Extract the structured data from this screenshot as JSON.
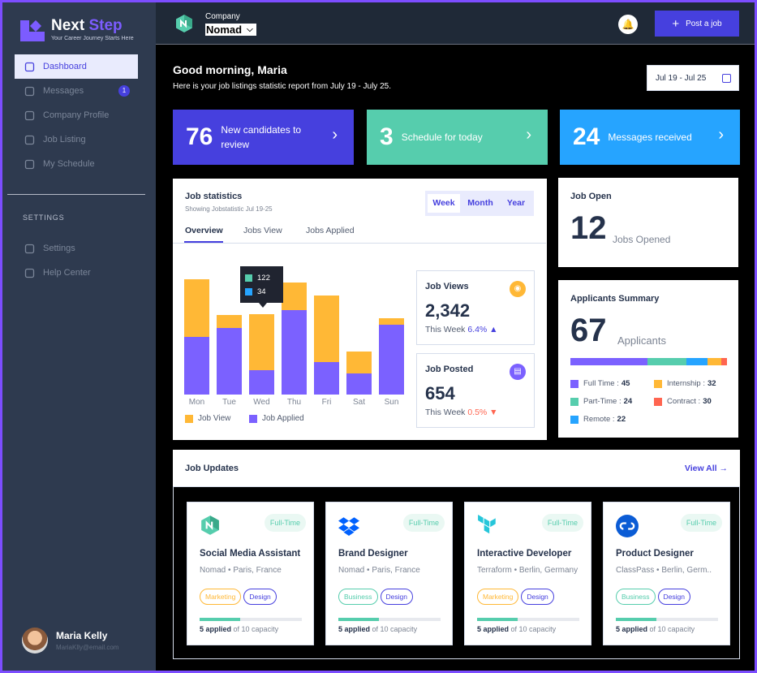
{
  "brand": {
    "title_a": "Next",
    "title_b": "Step",
    "tagline": "Your Career Journey Starts Here"
  },
  "nav": [
    {
      "label": "Dashboard",
      "icon": "home-icon",
      "active": true
    },
    {
      "label": "Messages",
      "icon": "message-icon",
      "badge": "1"
    },
    {
      "label": "Company Profile",
      "icon": "building-icon"
    },
    {
      "label": "Job Listing",
      "icon": "clipboard-icon"
    },
    {
      "label": "My Schedule",
      "icon": "calendar-icon"
    }
  ],
  "settings_heading": "SETTINGS",
  "settings_nav": [
    {
      "label": "Settings",
      "icon": "gear-icon"
    },
    {
      "label": "Help Center",
      "icon": "help-icon"
    }
  ],
  "user": {
    "name": "Maria Kelly",
    "email": "MariaKlly@email.com"
  },
  "header": {
    "company_label": "Company",
    "company_name": "Nomad",
    "post_label": "Post a job"
  },
  "greeting": {
    "title": "Good morning, Maria",
    "subtitle": "Here is your job listings statistic report from July 19 - July 25.",
    "date_range": "Jul 19 - Jul 25"
  },
  "stats": [
    {
      "num": "76",
      "line1": "New candidates to",
      "line2": "review",
      "color": "#4640de"
    },
    {
      "num": "3",
      "line1": "Schedule for today",
      "line2": "",
      "color": "#56cdad"
    },
    {
      "num": "24",
      "line1": "Messages received",
      "line2": "",
      "color": "#26a4ff"
    }
  ],
  "job_stats": {
    "title": "Job statistics",
    "subtitle": "Showing Jobstatistic Jul 19-25",
    "periods": [
      "Week",
      "Month",
      "Year"
    ],
    "tabs": [
      "Overview",
      "Jobs View",
      "Jobs Applied"
    ],
    "tooltip": {
      "view": "122",
      "applied": "34"
    },
    "views_card": {
      "title": "Job Views",
      "value": "2,342",
      "week_label": "This Week",
      "change": "6.4%"
    },
    "posted_card": {
      "title": "Job Posted",
      "value": "654",
      "week_label": "This Week",
      "change": "0.5%"
    }
  },
  "chart_data": {
    "type": "bar",
    "stacked": true,
    "categories": [
      "Mon",
      "Tue",
      "Wed",
      "Thu",
      "Fri",
      "Sat",
      "Sun"
    ],
    "series": [
      {
        "name": "Job View",
        "color": "#ffb836",
        "values": [
          73,
          17,
          71,
          35,
          84,
          27,
          8
        ]
      },
      {
        "name": "Job Applied",
        "color": "#7b61ff",
        "values": [
          73,
          84,
          31,
          107,
          41,
          27,
          88
        ]
      }
    ]
  },
  "job_open": {
    "title": "Job Open",
    "num": "12",
    "label": "Jobs Opened"
  },
  "applicants": {
    "title": "Applicants Summary",
    "num": "67",
    "label": "Applicants",
    "items": [
      {
        "name": "Full Time :",
        "value": "45",
        "color": "#7b61ff"
      },
      {
        "name": "Internship :",
        "value": "32",
        "color": "#ffb836"
      },
      {
        "name": "Part-Time :",
        "value": "24",
        "color": "#56cdad"
      },
      {
        "name": "Contract :",
        "value": "30",
        "color": "#ff6550"
      },
      {
        "name": "Remote :",
        "value": "22",
        "color": "#26a4ff"
      }
    ]
  },
  "updates": {
    "title": "Job Updates",
    "view_all": "View All",
    "jobs": [
      {
        "badge": "Full-Time",
        "title": "Social Media Assistant",
        "company": "Nomad",
        "location": "Paris, France",
        "tags": [
          [
            "Marketing",
            "mkt"
          ],
          [
            "Design",
            "des"
          ]
        ],
        "applied": "5 applied",
        "capacity": "of 10 capacity",
        "progress": 0.4,
        "logo": "nomad-logo-icon"
      },
      {
        "badge": "Full-Time",
        "title": "Brand Designer",
        "company": "Nomad",
        "location": "Paris, France",
        "tags": [
          [
            "Business",
            "bus"
          ],
          [
            "Design",
            "des"
          ]
        ],
        "applied": "5 applied",
        "capacity": "of 10 capacity",
        "progress": 0.4,
        "logo": "dropbox-logo-icon"
      },
      {
        "badge": "Full-Time",
        "title": "Interactive Developer",
        "company": "Terraform",
        "location": "Berlin, Germany",
        "tags": [
          [
            "Marketing",
            "mkt"
          ],
          [
            "Design",
            "des"
          ]
        ],
        "applied": "5 applied",
        "capacity": "of 10 capacity",
        "progress": 0.4,
        "logo": "terraform-logo-icon"
      },
      {
        "badge": "Full-Time",
        "title": "Product Designer",
        "company": "ClassPass",
        "location": "Berlin, Germ..",
        "tags": [
          [
            "Business",
            "bus"
          ],
          [
            "Design",
            "des"
          ]
        ],
        "applied": "5 applied",
        "capacity": "of 10 capacity",
        "progress": 0.4,
        "logo": "classpass-logo-icon"
      }
    ]
  }
}
